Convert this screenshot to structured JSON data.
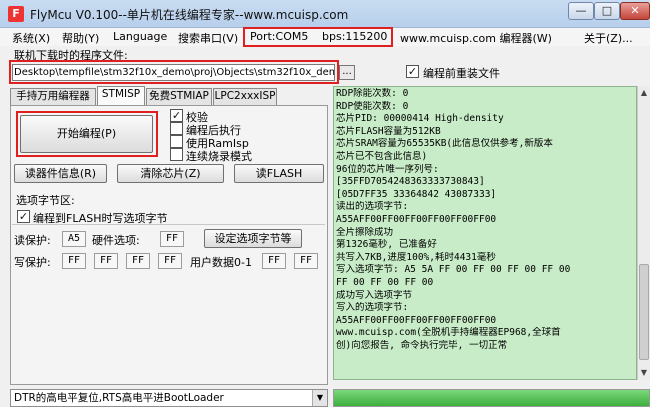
{
  "window": {
    "title": "FlyMcu V0.100--单片机在线编程专家--www.mcuisp.com",
    "min_glyph": "—",
    "max_glyph": "□",
    "close_glyph": "✕"
  },
  "menu": {
    "system": "系统(X)",
    "help": "帮助(Y)",
    "language": "Language",
    "search_port": "搜索串口(V)",
    "port": "Port:COM5",
    "bps": "bps:115200",
    "programmer": "www.mcuisp.com 编程器(W)",
    "about": "关于(Z)..."
  },
  "file": {
    "label": "联机下载时的程序文件:",
    "path": "Desktop\\tempfile\\stm32f10x_demo\\proj\\Objects\\stm32f10x_demo.hex",
    "browse": "...",
    "reload_label": "编程前重装文件",
    "reload_checked": "✓"
  },
  "tabs": [
    "手持万用编程器",
    "STMISP",
    "免费STMIAP",
    "LPC2xxxISP"
  ],
  "stmisp": {
    "start_button": "开始编程(P)",
    "options": [
      {
        "label": "校验",
        "check": "✓"
      },
      {
        "label": "编程后执行",
        "check": ""
      },
      {
        "label": "使用RamIsp",
        "check": ""
      },
      {
        "label": "连续烧录模式",
        "check": ""
      }
    ],
    "read_info": "读器件信息(R)",
    "erase_chip": "清除芯片(Z)",
    "read_flash": "读FLASH"
  },
  "option_bytes": {
    "title": "选项字节区:",
    "program_to_flash": "编程到FLASH时写选项字节",
    "program_check": "✓",
    "read_protect_label": "读保护:",
    "read_protect_value": "A5",
    "hw_option_label": "硬件选项:",
    "hw_option_value": "FF",
    "set_button": "设定选项字节等",
    "write_protect_label": "写保护:",
    "write_protect_values": [
      "FF",
      "FF",
      "FF",
      "FF"
    ],
    "user_data_label": "用户数据0-1",
    "user_data_values": [
      "FF",
      "FF"
    ]
  },
  "log": [
    "RDP除能次数: 0",
    "RDP使能次数: 0",
    "芯片PID: 00000414  High-density",
    "芯片FLASH容量为512KB",
    "芯片SRAM容量为65535KB(此信息仅供参考,新版本",
    "芯片已不包含此信息)",
    "96位的芯片唯一序列号:",
    "[35FFD7054248363333730843]",
    "[05D7FF35 33364842 43087333]",
    "读出的选项字节:",
    "A55AFF00FF00FF00FF00FF00FF00",
    "全片擦除成功",
    "第1326毫秒, 已准备好",
    "共写入7KB,进度100%,耗时4431毫秒",
    "写入选项字节:  A5 5A FF 00 FF 00 FF 00 FF 00",
    "FF 00 FF 00 FF 00",
    "成功写入选项字节",
    "写入的选项字节:",
    "A55AFF00FF00FF00FF00FF00FF00",
    "www.mcuisp.com(全脱机手持编程器EP968,全球首",
    "创)向您报告, 命令执行完毕, 一切正常"
  ],
  "reset_mode": "DTR的高电平复位,RTS高电平进BootLoader",
  "progress_percent": 100,
  "colors": {
    "highlight": "#e02020",
    "log_background": "#c7ecc7",
    "progress": "#3caf3c"
  }
}
